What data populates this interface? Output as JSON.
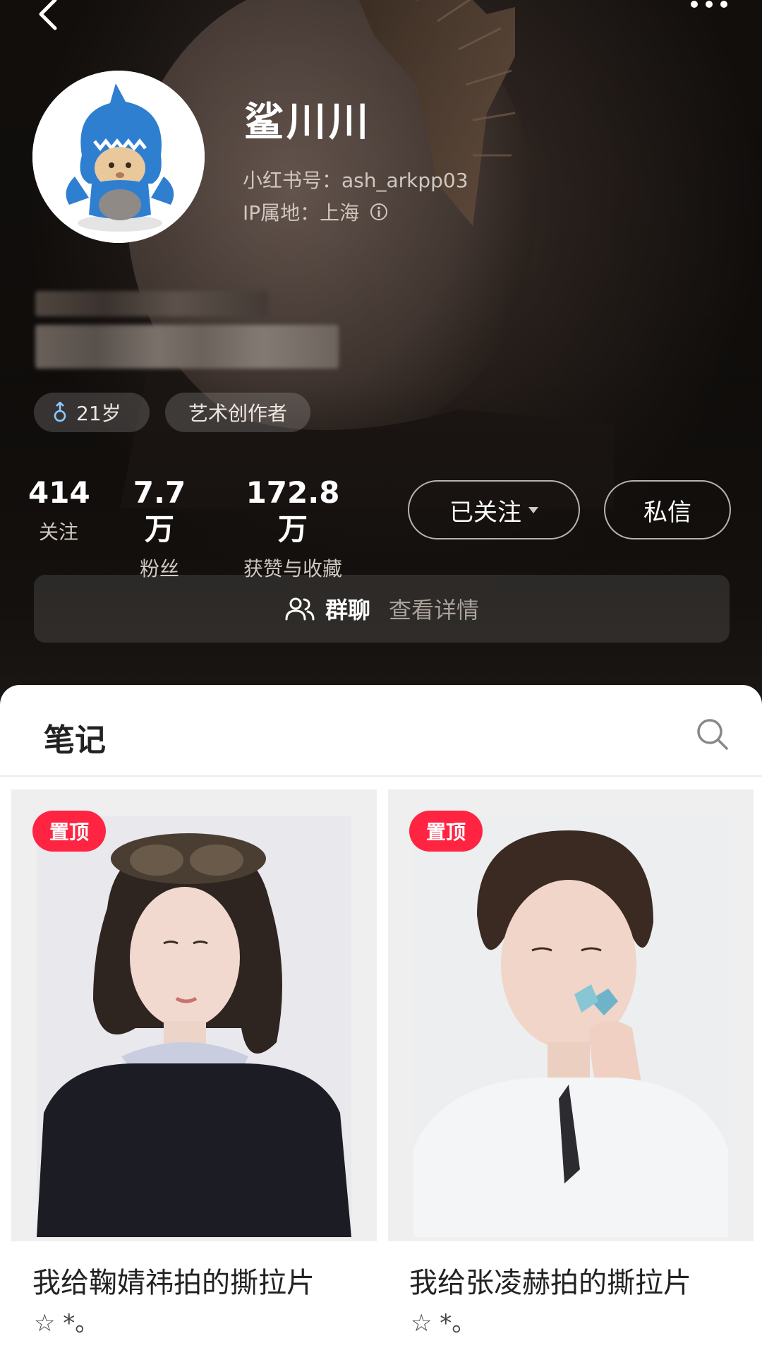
{
  "profile": {
    "nickname": "鲨川川",
    "red_id": "小红书号：ash_arkpp03",
    "ip": "IP属地：上海",
    "tags": {
      "age": "21岁",
      "role": "艺术创作者"
    },
    "stats": [
      {
        "value": "414",
        "label": "关注"
      },
      {
        "value": "7.7万",
        "label": "粉丝"
      },
      {
        "value": "172.8万",
        "label": "获赞与收藏"
      }
    ],
    "buttons": {
      "followed": "已关注",
      "message": "私信"
    },
    "group": {
      "label": "群聊",
      "detail": "查看详情"
    }
  },
  "notes": {
    "title": "笔记",
    "cards": [
      {
        "pin": "置顶",
        "title": "我给鞠婧祎拍的撕拉片",
        "subtitle": "☆ *。"
      },
      {
        "pin": "置顶",
        "title": "我给张凌赫拍的撕拉片",
        "subtitle": "☆ *。"
      }
    ]
  },
  "colors": {
    "accent": "#ff2442",
    "dark_bg": "#1a1613"
  }
}
